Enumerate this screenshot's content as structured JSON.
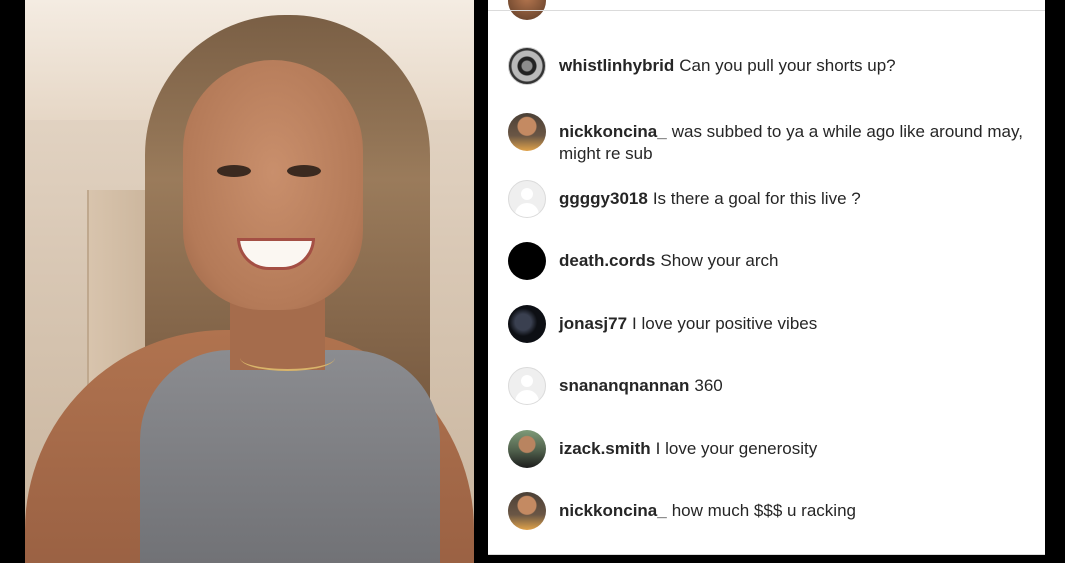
{
  "comments": [
    {
      "username": "whistlinhybrid",
      "message": "Can you pull your shorts up?",
      "avatar": "wheel-avatar"
    },
    {
      "username": "nickkoncina_",
      "message": "was subbed to ya a while ago like around may, might re sub",
      "avatar": "man-avatar"
    },
    {
      "username": "ggggy3018",
      "message": "Is there a goal for this live ?",
      "avatar": "default-avatar"
    },
    {
      "username": "death.cords",
      "message": "Show your arch",
      "avatar": "black-avatar"
    },
    {
      "username": "jonasj77",
      "message": "I love your positive vibes",
      "avatar": "dark-avatar"
    },
    {
      "username": "snananqnannan",
      "message": "360",
      "avatar": "default-avatar"
    },
    {
      "username": "izack.smith",
      "message": "I love your generosity",
      "avatar": "photo-avatar"
    },
    {
      "username": "nickkoncina_",
      "message": "how much $$$ u racking",
      "avatar": "man-avatar"
    }
  ],
  "colors": {
    "text": "#262626",
    "divider": "#dbdbdb",
    "background": "#ffffff",
    "letterbox": "#000000"
  }
}
